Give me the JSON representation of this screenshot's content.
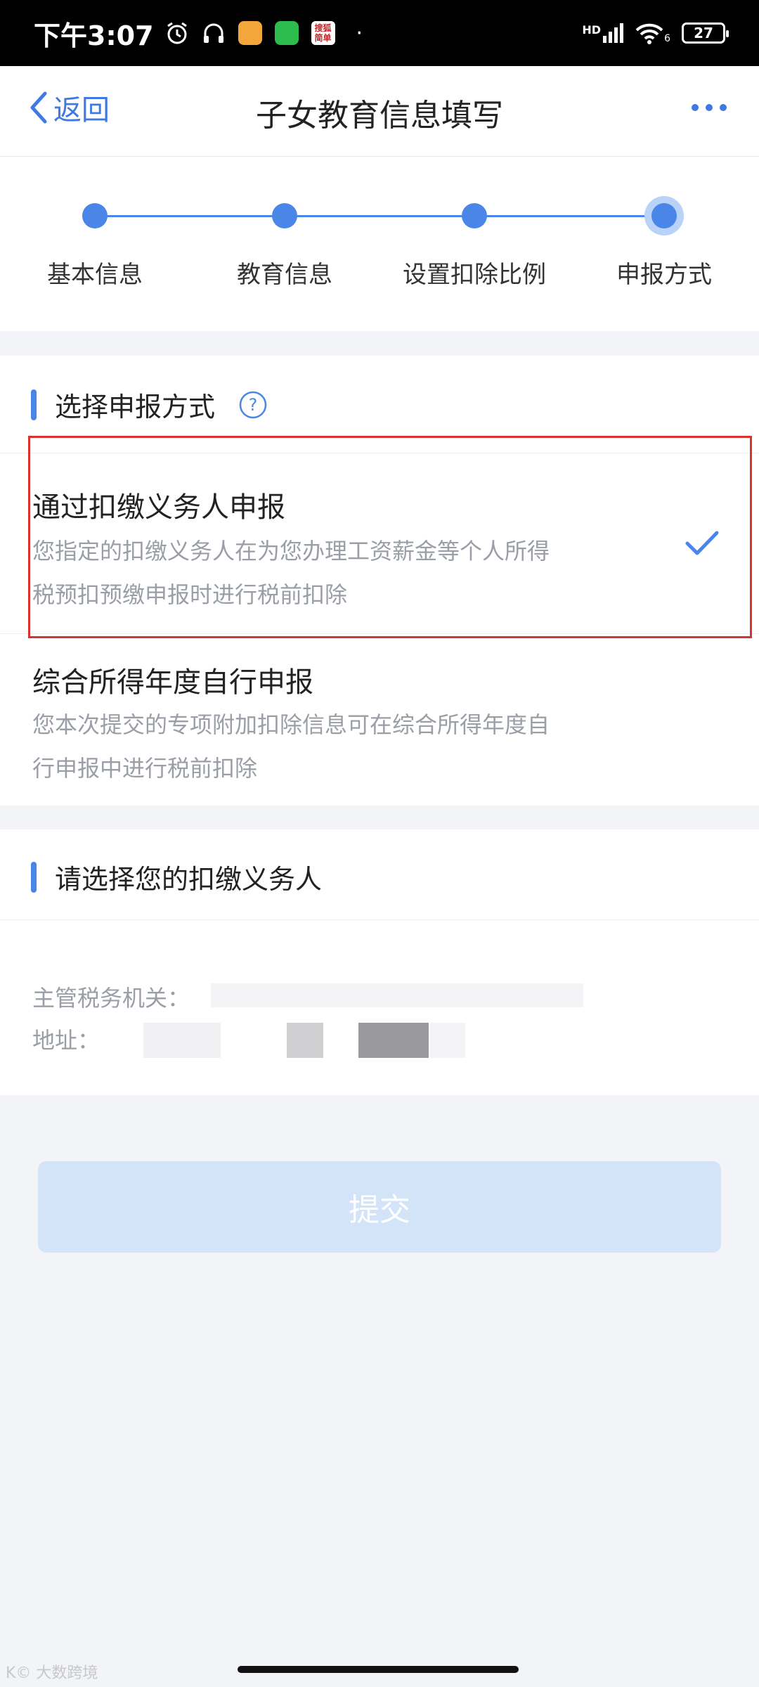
{
  "status_bar": {
    "time": "下午3:07",
    "tax_app_text": "搜狐\n简单",
    "signal": "HD",
    "wifi_badge": "6",
    "battery": "27"
  },
  "nav": {
    "back_label": "返回",
    "title": "子女教育信息填写"
  },
  "steps": [
    {
      "label": "基本信息"
    },
    {
      "label": "教育信息"
    },
    {
      "label": "设置扣除比例"
    },
    {
      "label": "申报方式"
    }
  ],
  "section_method": {
    "title": "选择申报方式",
    "options": [
      {
        "title": "通过扣缴义务人申报",
        "desc_line1": "您指定的扣缴义务人在为您办理工资薪金等个人所得",
        "desc_line2": "税预扣预缴申报时进行税前扣除",
        "selected": true
      },
      {
        "title": "综合所得年度自行申报",
        "desc_line1": "您本次提交的专项附加扣除信息可在综合所得年度自",
        "desc_line2": "行申报中进行税前扣除",
        "selected": false
      }
    ]
  },
  "section_agent": {
    "title": "请选择您的扣缴义务人",
    "tax_office_label": "主管税务机关：",
    "address_label": "地址："
  },
  "submit_label": "提交",
  "watermark": "K© 大数跨境",
  "colors": {
    "accent": "#4a86e8",
    "highlight_border": "#d9332f",
    "submit_disabled": "#d3e4f9"
  }
}
